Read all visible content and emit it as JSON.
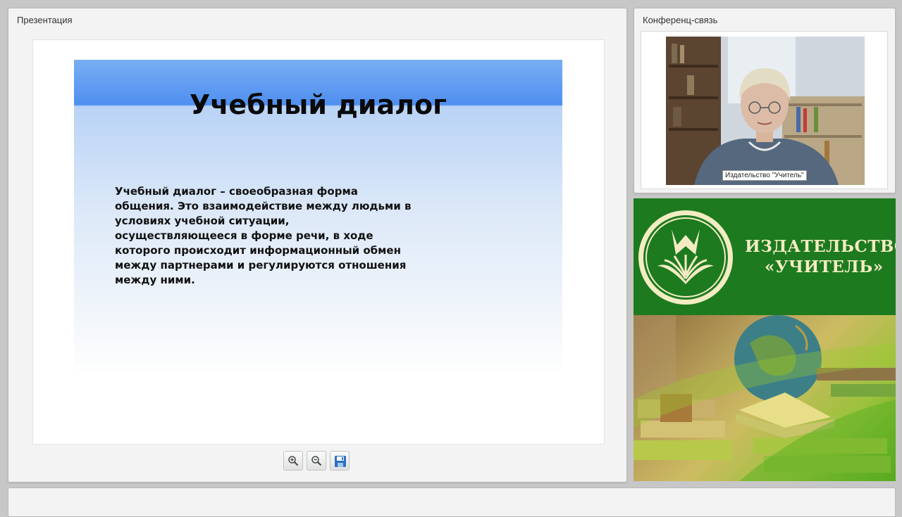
{
  "presentation": {
    "title": "Презентация",
    "slide": {
      "title": "Учебный диалог",
      "body_lines": [
        "Учебный диалог – своеобразная форма",
        "общения. Это взаимодействие между людьми в",
        "условиях учебной ситуации,",
        "осуществляющееся в форме речи, в ходе",
        "которого происходит информационный обмен",
        "между партнерами и регулируются отношения",
        "между ними."
      ]
    },
    "toolbar": [
      "zoom-in-icon",
      "zoom-out-icon",
      "save-icon"
    ]
  },
  "conference": {
    "title": "Конференц-связь",
    "caption": "Издательство \"Учитель\""
  },
  "banner": {
    "line1": "ИЗДАТЕЛЬСТВО",
    "line2": "«УЧИТЕЛЬ»",
    "colors": {
      "green": "#1d7a1f",
      "text": "#f3ecc3"
    }
  }
}
